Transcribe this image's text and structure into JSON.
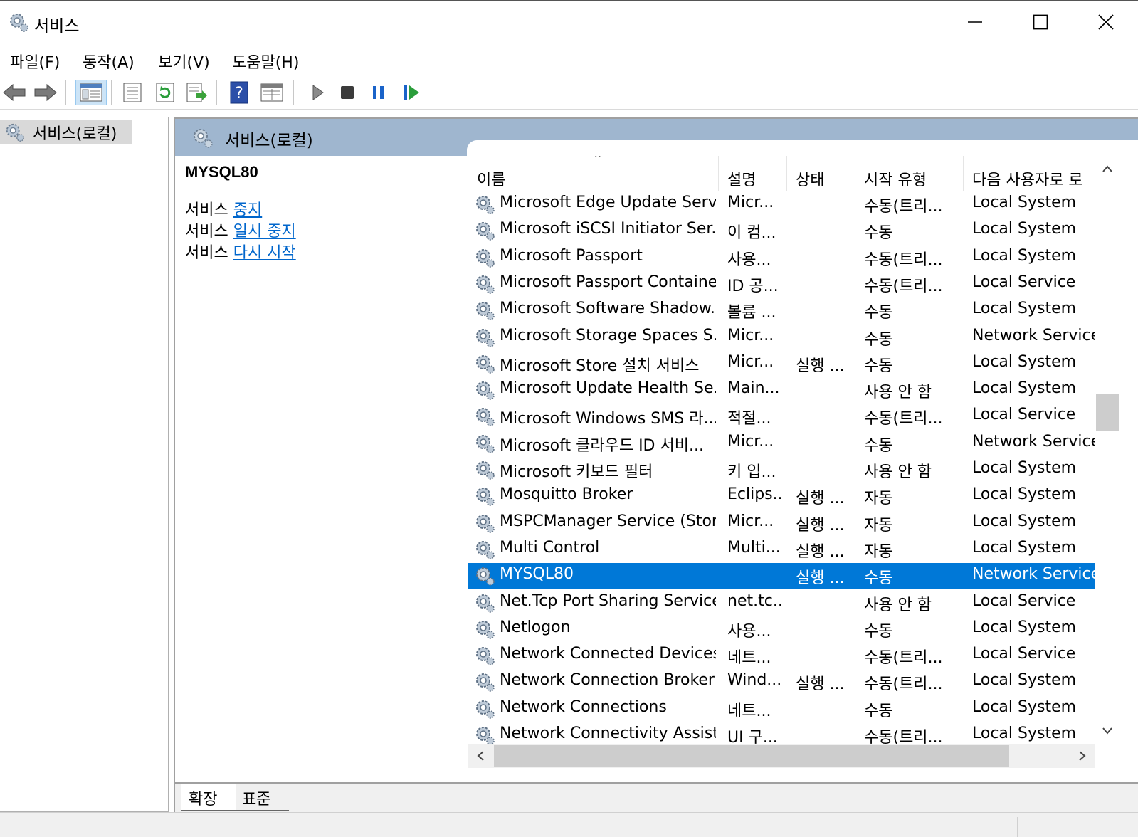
{
  "window": {
    "title": "서비스",
    "icon": "gear-icon"
  },
  "menu": {
    "items": [
      {
        "label": "파일(F)"
      },
      {
        "label": "동작(A)"
      },
      {
        "label": "보기(V)"
      },
      {
        "label": "도움말(H)"
      }
    ]
  },
  "toolbar": {
    "icons": [
      "back-arrow-icon",
      "forward-arrow-icon",
      "show-tree-icon",
      "properties-icon",
      "refresh-icon",
      "export-list-icon",
      "help-icon",
      "console-view-icon",
      "start-service-icon",
      "stop-service-icon",
      "pause-service-icon",
      "resume-service-icon"
    ]
  },
  "tree": {
    "root_label": "서비스(로컬)"
  },
  "main": {
    "header_label": "서비스(로컬)",
    "selected_service": "MYSQL80",
    "actions": [
      {
        "prefix": "서비스",
        "link": "중지"
      },
      {
        "prefix": "서비스",
        "link": "일시 중지"
      },
      {
        "prefix": "서비스",
        "link": "다시 시작"
      }
    ]
  },
  "list": {
    "columns": {
      "name": "이름",
      "description": "설명",
      "status": "상태",
      "startup": "시작 유형",
      "logon": "다음 사용자로 로"
    },
    "rows": [
      {
        "name": "Microsoft Edge Update Serv...",
        "desc": "Micr...",
        "status": "",
        "startup": "수동(트리...",
        "logon": "Local System"
      },
      {
        "name": "Microsoft iSCSI Initiator Ser...",
        "desc": "이 컴...",
        "status": "",
        "startup": "수동",
        "logon": "Local System"
      },
      {
        "name": "Microsoft Passport",
        "desc": "사용...",
        "status": "",
        "startup": "수동(트리...",
        "logon": "Local System"
      },
      {
        "name": "Microsoft Passport Container",
        "desc": "ID 공...",
        "status": "",
        "startup": "수동(트리...",
        "logon": "Local Service"
      },
      {
        "name": "Microsoft Software Shadow...",
        "desc": "볼륨 ...",
        "status": "",
        "startup": "수동",
        "logon": "Local System"
      },
      {
        "name": "Microsoft Storage Spaces S...",
        "desc": "Micr...",
        "status": "",
        "startup": "수동",
        "logon": "Network Service"
      },
      {
        "name": "Microsoft Store 설치 서비스",
        "desc": "Micr...",
        "status": "실행 ...",
        "startup": "수동",
        "logon": "Local System"
      },
      {
        "name": "Microsoft Update Health Se...",
        "desc": "Main...",
        "status": "",
        "startup": "사용 안 함",
        "logon": "Local System"
      },
      {
        "name": "Microsoft Windows SMS 라...",
        "desc": "적절...",
        "status": "",
        "startup": "수동(트리...",
        "logon": "Local Service"
      },
      {
        "name": "Microsoft 클라우드 ID 서비...",
        "desc": "Micr...",
        "status": "",
        "startup": "수동",
        "logon": "Network Service"
      },
      {
        "name": "Microsoft 키보드 필터",
        "desc": "키 입...",
        "status": "",
        "startup": "사용 안 함",
        "logon": "Local System"
      },
      {
        "name": "Mosquitto Broker",
        "desc": "Eclips...",
        "status": "실행 ...",
        "startup": "자동",
        "logon": "Local System"
      },
      {
        "name": "MSPCManager Service (Store)",
        "desc": "Micr...",
        "status": "실행 ...",
        "startup": "자동",
        "logon": "Local System"
      },
      {
        "name": "Multi Control",
        "desc": "Multi...",
        "status": "실행 ...",
        "startup": "자동",
        "logon": "Local System"
      },
      {
        "name": "MYSQL80",
        "desc": "",
        "status": "실행 ...",
        "startup": "수동",
        "logon": "Network Service",
        "selected": true
      },
      {
        "name": "Net.Tcp Port Sharing Service",
        "desc": "net.tc...",
        "status": "",
        "startup": "사용 안 함",
        "logon": "Local Service"
      },
      {
        "name": "Netlogon",
        "desc": "사용...",
        "status": "",
        "startup": "수동",
        "logon": "Local System"
      },
      {
        "name": "Network Connected Devices...",
        "desc": "네트...",
        "status": "",
        "startup": "수동(트리...",
        "logon": "Local Service"
      },
      {
        "name": "Network Connection Broker",
        "desc": "Wind...",
        "status": "실행 ...",
        "startup": "수동(트리...",
        "logon": "Local System"
      },
      {
        "name": "Network Connections",
        "desc": "네트...",
        "status": "",
        "startup": "수동",
        "logon": "Local System"
      },
      {
        "name": "Network Connectivity Assist...",
        "desc": "UI 구...",
        "status": "",
        "startup": "수동(트리...",
        "logon": "Local System"
      }
    ]
  },
  "tabs": [
    {
      "label": "확장",
      "active": true
    },
    {
      "label": "표준",
      "active": false
    }
  ],
  "colors": {
    "selection": "#0078d7",
    "header_band": "#9fb6cf",
    "link": "#0066cc"
  }
}
